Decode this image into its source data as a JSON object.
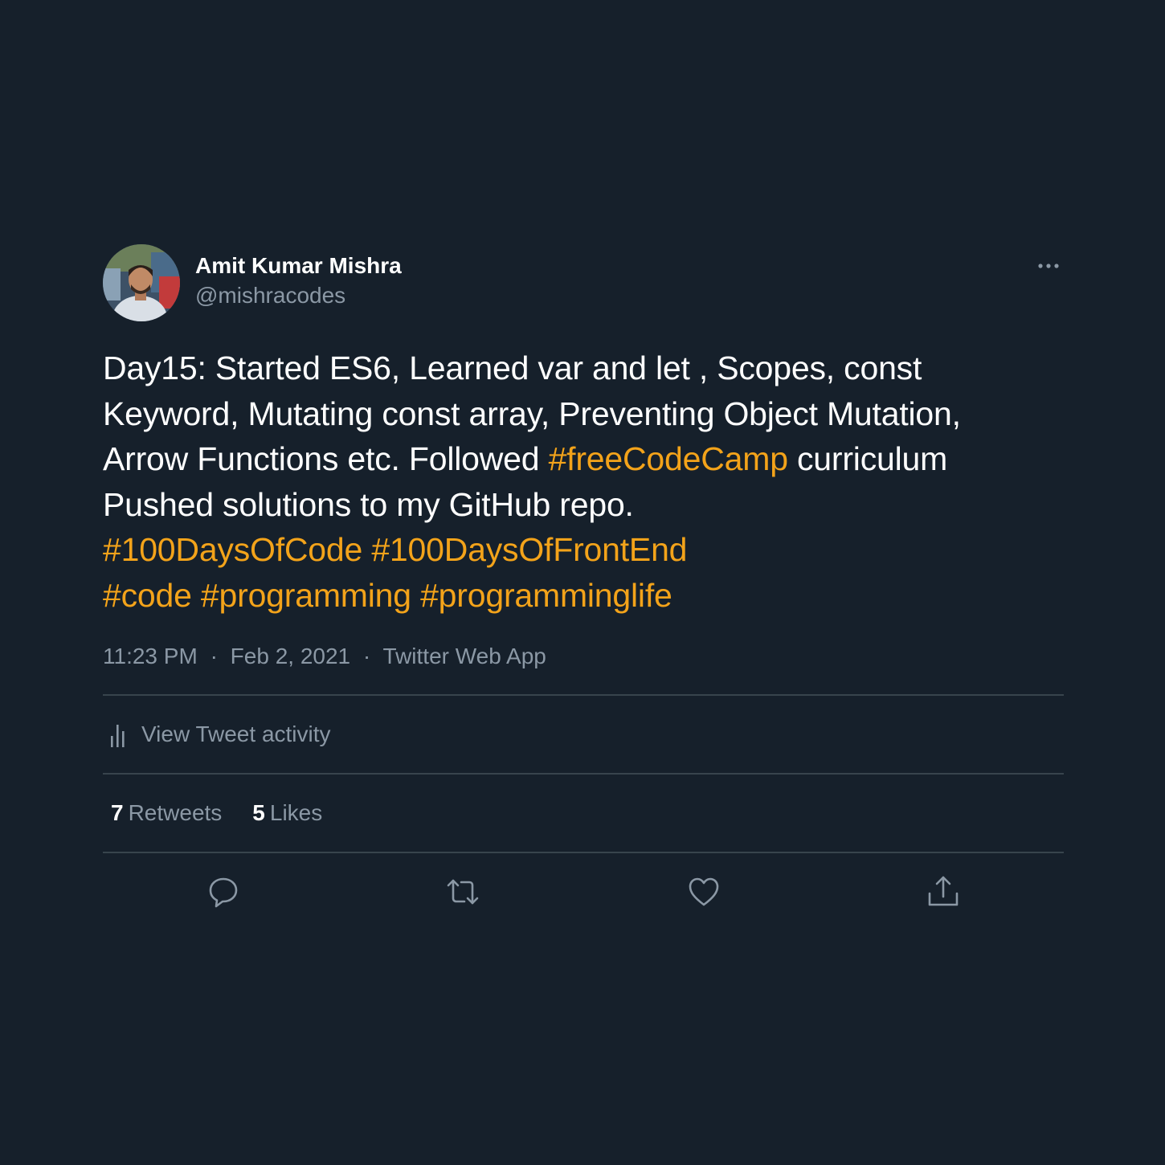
{
  "author": {
    "display_name": "Amit Kumar Mishra",
    "handle": "@mishracodes"
  },
  "tweet": {
    "lines": [
      [
        {
          "t": "Day15: Started ES6, Learned  var and let , Scopes, const",
          "tag": false
        }
      ],
      [
        {
          "t": "Keyword, Mutating const array, Preventing Object Mutation,",
          "tag": false
        }
      ],
      [
        {
          "t": "Arrow Functions etc. Followed ",
          "tag": false
        },
        {
          "t": "#freeCodeCamp",
          "tag": true
        },
        {
          "t": " curriculum",
          "tag": false
        }
      ],
      [
        {
          "t": "Pushed solutions to my GitHub repo.",
          "tag": false
        }
      ],
      [
        {
          "t": "#100DaysOfCode",
          "tag": true
        },
        {
          "t": " ",
          "tag": false
        },
        {
          "t": "#100DaysOfFrontEnd",
          "tag": true
        }
      ],
      [
        {
          "t": "#code",
          "tag": true
        },
        {
          "t": " ",
          "tag": false
        },
        {
          "t": "#programming",
          "tag": true
        },
        {
          "t": " ",
          "tag": false
        },
        {
          "t": "#programminglife",
          "tag": true
        }
      ]
    ],
    "time": "11:23 PM",
    "date": "Feb 2, 2021",
    "source": "Twitter Web App",
    "separator": "·"
  },
  "activity": {
    "label": "View Tweet activity",
    "icon": "bar-chart-icon"
  },
  "stats": {
    "retweets_count": "7",
    "retweets_label": "Retweets",
    "likes_count": "5",
    "likes_label": "Likes"
  },
  "actions": {
    "icons": [
      "reply-icon",
      "retweet-icon",
      "like-icon",
      "share-icon"
    ]
  },
  "colors": {
    "background": "#16202b",
    "hashtag": "#f3a31a",
    "secondary_text": "#8b98a5",
    "divider": "#38444d"
  }
}
